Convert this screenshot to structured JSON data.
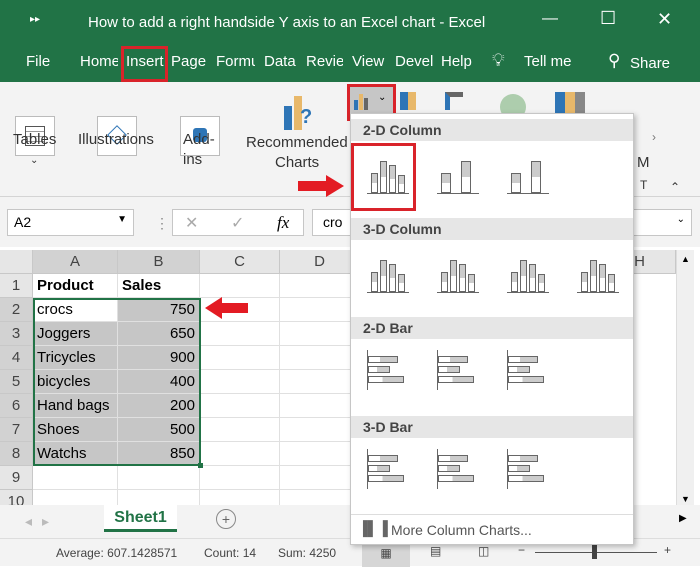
{
  "window": {
    "title": "How to add a right handside Y axis to an Excel chart  -  Excel",
    "minimize": "—",
    "maximize": "☐",
    "close": "✕"
  },
  "tabs": [
    "File",
    "Home",
    "Insert",
    "Page",
    "Formu",
    "Data",
    "Revie",
    "View",
    "Devel",
    "Help"
  ],
  "tell_me": "Tell me",
  "share": "Share",
  "ribbon": {
    "tables": "Tables",
    "illustrations": "Illustrations",
    "addins_1": "Add-",
    "addins_2": "ins",
    "recommended_1": "Recommended",
    "recommended_2": "Charts",
    "more_partial": "M",
    "more_partial2": "T"
  },
  "formula_bar": {
    "name_box": "A2",
    "fx": "fx",
    "value": "cro"
  },
  "columns": [
    "A",
    "B",
    "C",
    "D",
    "H"
  ],
  "rows": [
    "1",
    "2",
    "3",
    "4",
    "5",
    "6",
    "7",
    "8",
    "9",
    "10"
  ],
  "table": {
    "headers": [
      "Product",
      "Sales"
    ],
    "data": [
      [
        "crocs",
        "750"
      ],
      [
        "Joggers",
        "650"
      ],
      [
        "Tricycles",
        "900"
      ],
      [
        "bicycles",
        "400"
      ],
      [
        "Hand bags",
        "200"
      ],
      [
        "Shoes",
        "500"
      ],
      [
        "Watchs",
        "850"
      ]
    ]
  },
  "sheet_tab": "Sheet1",
  "status": {
    "average": "Average: 607.1428571",
    "count": "Count: 14",
    "sum": "Sum: 4250"
  },
  "dropdown": {
    "sections": [
      "2-D Column",
      "3-D Column",
      "2-D Bar",
      "3-D Bar"
    ],
    "more": "More Column Charts..."
  },
  "colors": {
    "excel_green": "#217346",
    "highlight_red": "#d9232a",
    "selection": "#c6c6c6"
  }
}
